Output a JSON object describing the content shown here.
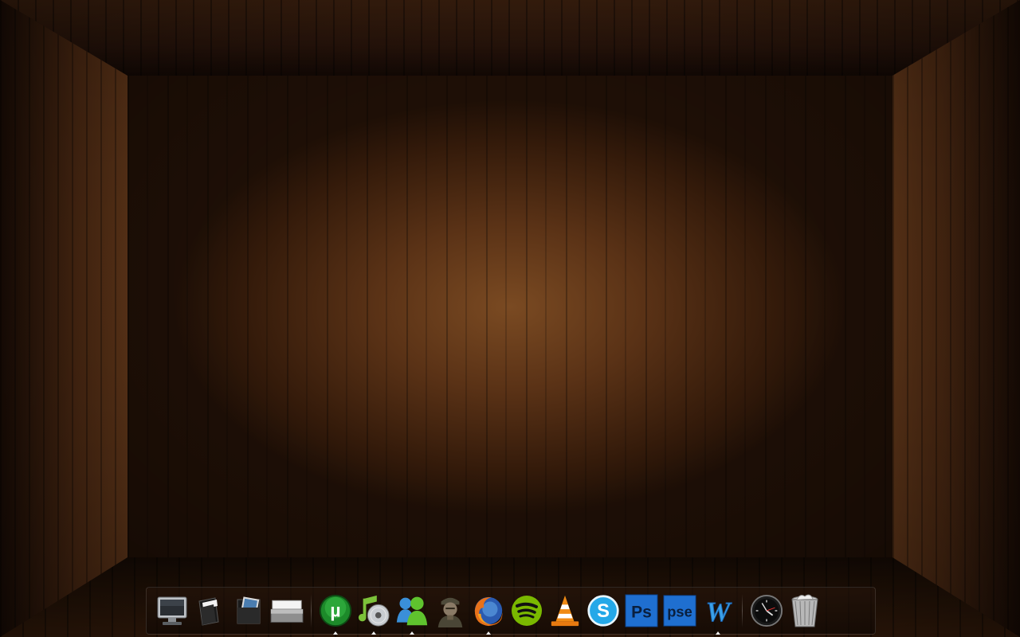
{
  "desktop": {
    "wallpaper": "wood-room",
    "colors": {
      "wood_light": "#7a4a22",
      "wood_dark": "#1e0f06"
    }
  },
  "dock": {
    "system_items": [
      {
        "name": "computer-icon",
        "running": false
      },
      {
        "name": "documents-folder-icon",
        "running": false
      },
      {
        "name": "pictures-folder-icon",
        "running": false
      },
      {
        "name": "mail-icon",
        "running": false
      }
    ],
    "app_items": [
      {
        "name": "utorrent-icon",
        "glyph": "µ",
        "running": true
      },
      {
        "name": "itunes-icon",
        "running": true
      },
      {
        "name": "messenger-icon",
        "running": true
      },
      {
        "name": "game-soldier-icon",
        "running": false
      },
      {
        "name": "firefox-icon",
        "running": true
      },
      {
        "name": "spotify-icon",
        "running": false
      },
      {
        "name": "vlc-icon",
        "running": false
      },
      {
        "name": "skype-icon",
        "glyph": "S",
        "running": false
      },
      {
        "name": "photoshop-icon",
        "glyph": "Ps",
        "running": false
      },
      {
        "name": "photoshop-elements-icon",
        "glyph": "pse",
        "running": false
      },
      {
        "name": "word-icon",
        "glyph": "W",
        "running": true
      }
    ],
    "utility_items": [
      {
        "name": "clock-icon",
        "running": false
      },
      {
        "name": "trash-icon",
        "running": false
      }
    ]
  }
}
